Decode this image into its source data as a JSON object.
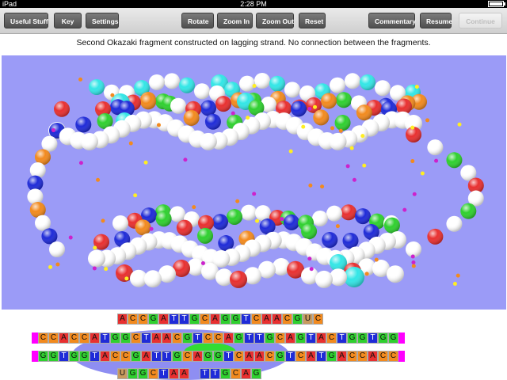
{
  "status": {
    "device": "iPad",
    "time": "2:28 PM"
  },
  "toolbar": {
    "useful_stuff": "Useful Stuff",
    "key": "Key",
    "settings": "Settings",
    "rotate": "Rotate",
    "zoom_in": "Zoom In",
    "zoom_out": "Zoom Out",
    "reset": "Reset",
    "commentary": "Commentary",
    "resume": "Resume",
    "continue": "Continue"
  },
  "caption": "Second Okazaki fragment constructed on lagging strand. No connection between the fragments.",
  "colors": {
    "background": "#9b9bf7",
    "A": "#e83030",
    "T": "#1f2bd8",
    "G": "#2fd02f",
    "C": "#f28a1e",
    "U": "#c89a5e",
    "gap": "#ffffff",
    "cap": "#ff00ff",
    "overlay": "#8e8ef2",
    "enzyme": "#33dd33",
    "sphere_white": "#ffffff",
    "sphere_cyan": "#33e6e6",
    "sphere_magenta": "#cc22cc",
    "sphere_yellow": "#ffee22"
  },
  "sequence": {
    "rows": [
      {
        "name": "upper-okazaki-fragment",
        "cells": "ACCGATTGCAGGTCAACGUC"
      },
      {
        "name": "template-strand-top",
        "cells": "CCACCATGGCTAACGTCCAGTTGCAGTACTGGTGG"
      },
      {
        "name": "template-strand-bottom",
        "cells": "GGTGGTACCGATTGCAGGTCAACGTCATGACCACC"
      },
      {
        "name": "lower-okazaki-fragment",
        "cells": "UGGCTAA TTGCAG"
      }
    ]
  }
}
